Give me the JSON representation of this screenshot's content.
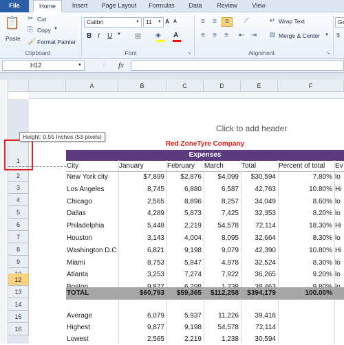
{
  "tabs": [
    "File",
    "Home",
    "Insert",
    "Page Layout",
    "Formulas",
    "Data",
    "Review",
    "View"
  ],
  "ribbon": {
    "clipboard": {
      "paste": "Paste",
      "cut": "Cut",
      "copy": "Copy",
      "format_painter": "Format Painter",
      "label": "Clipboard"
    },
    "font": {
      "name": "Calibri",
      "size": "11",
      "label": "Font"
    },
    "alignment": {
      "wrap_text": "Wrap Text",
      "merge_center": "Merge & Center",
      "label": "Alignment"
    },
    "number": {
      "format_partial": "Ge"
    }
  },
  "formula_bar": {
    "name_box": "H12",
    "fx": "fx"
  },
  "columns": [
    "A",
    "B",
    "C",
    "D",
    "E",
    "F"
  ],
  "rows": [
    "1",
    "2",
    "3",
    "4",
    "5",
    "6",
    "7",
    "8",
    "9",
    "10",
    "11",
    "12",
    "13",
    "14",
    "15",
    "16"
  ],
  "selected_row": "12",
  "header_placeholder": "Click to add header",
  "tooltip": "Height: 0.55 Inches (53 pixels)",
  "sheet": {
    "title": "Red ZoneTyre Company",
    "subtitle": "Expenses",
    "headers": [
      "City",
      "January",
      "February",
      "March",
      "Total",
      "Percent of total",
      "Ev"
    ],
    "rows": [
      [
        "New York city",
        "$7,899",
        "$2,876",
        "$4,099",
        "$30,594",
        "7.80%",
        "lo"
      ],
      [
        "Los Angeles",
        "8,745",
        "6,880",
        "6,587",
        "42,763",
        "10.80%",
        "Hi"
      ],
      [
        "Chicago",
        "2,565",
        "8,896",
        "8,257",
        "34,049",
        "8.60%",
        "lo"
      ],
      [
        "Dallas",
        "4,289",
        "5,873",
        "7,425",
        "32,353",
        "8.20%",
        "lo"
      ],
      [
        "Philadelphia",
        "5,448",
        "2,219",
        "54,578",
        "72,114",
        "18.30%",
        "Hi"
      ],
      [
        "Houston",
        "3,143",
        "4,004",
        "8,095",
        "32,664",
        "8.30%",
        "lo"
      ],
      [
        "Washington D.C",
        "6,821",
        "9,198",
        "9,079",
        "42,390",
        "10.80%",
        "Hi"
      ],
      [
        "Miami",
        "8,753",
        "5,847",
        "4,978",
        "32,524",
        "8.30%",
        "lo"
      ],
      [
        "Atlanta",
        "3,253",
        "7,274",
        "7,922",
        "36,265",
        "9.20%",
        "lo"
      ],
      [
        "Boston",
        "9,877",
        "6,298",
        "1,238",
        "38,463",
        "9.80%",
        "lo"
      ]
    ],
    "total": [
      "TOTAL",
      "$60,793",
      "$59,365",
      "$112,258",
      "$394,179",
      "100.00%"
    ],
    "stats": [
      [
        "Average",
        "6,079",
        "5,937",
        "11,226",
        "39,418"
      ],
      [
        "Highest",
        "9,877",
        "9,198",
        "54,578",
        "72,114"
      ],
      [
        "Lowest",
        "2,565",
        "2,219",
        "1,238",
        "30,594"
      ]
    ]
  },
  "colors": {
    "band": "#5c3a7e",
    "title": "#e0201a",
    "total": "#a6a6a6",
    "selected_row": "#f7d37e",
    "highlight": "#e02020"
  }
}
